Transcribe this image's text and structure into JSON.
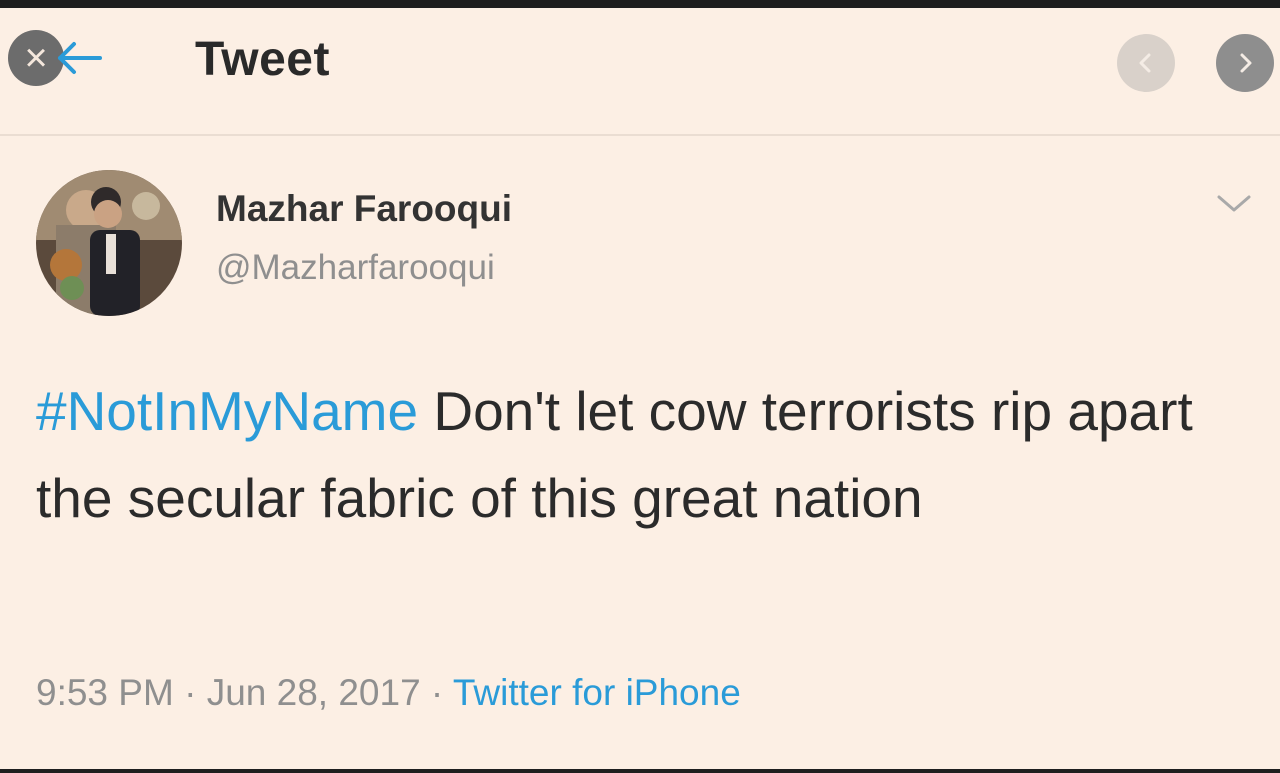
{
  "header": {
    "title": "Tweet",
    "close_icon": "close-icon",
    "back_icon": "back-arrow-icon",
    "prev_icon": "chevron-left-icon",
    "next_icon": "chevron-right-icon"
  },
  "author": {
    "name": "Mazhar Farooqui",
    "handle": "@Mazharfarooqui",
    "menu_icon": "chevron-down-icon"
  },
  "tweet": {
    "hashtag": "#NotInMyName",
    "body": " Don't let cow terrorists rip apart the secular fabric of this great nation"
  },
  "meta": {
    "time": "9:53 PM",
    "separator": " · ",
    "date": "Jun 28, 2017",
    "source": "Twitter for iPhone"
  },
  "colors": {
    "background": "#fcefe4",
    "link": "#2a9bd8",
    "secondary_text": "#8f8f8f"
  }
}
